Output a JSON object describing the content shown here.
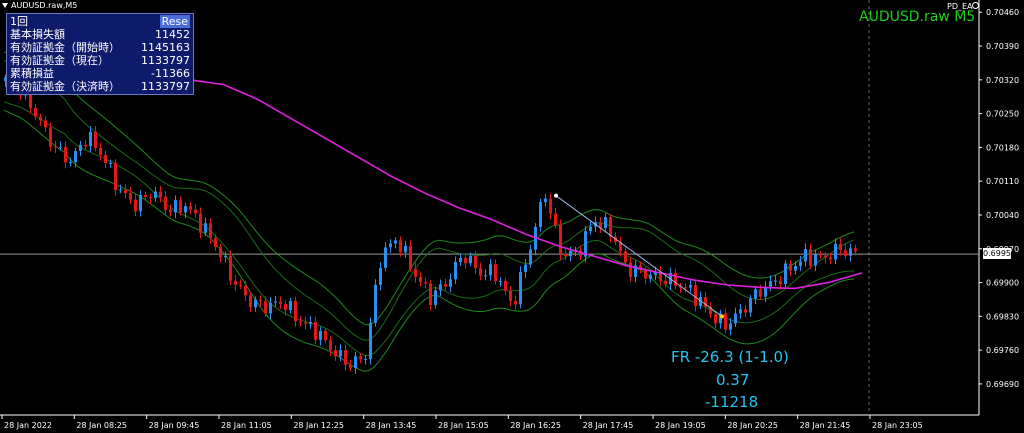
{
  "window": {
    "tab_label": "AUDUSD.raw,M5"
  },
  "info_panel": {
    "rows": [
      {
        "label": "1回",
        "value": "",
        "button": "Rese"
      },
      {
        "label": "基本損失額",
        "value": "11452"
      },
      {
        "label": "有効証拠金（開始時）",
        "value": "1145163"
      },
      {
        "label": "有効証拠金（現在）",
        "value": "1133797"
      },
      {
        "label": "累積損益",
        "value": "-11366"
      },
      {
        "label": "有効証拠金（決済時）",
        "value": "1133797"
      }
    ]
  },
  "ea": {
    "name": "PD_EA",
    "icon": "smiley-icon"
  },
  "watermark": "AUDUSD.raw M5",
  "current_price": "0.69959",
  "annotation": {
    "line1": "FR -26.3 (1-1.0)",
    "line2": "0.37",
    "line3": "-11218"
  },
  "colors": {
    "bull": "#2b8ff0",
    "bear": "#e01818",
    "ma": "#e020e0",
    "band_outer": "#1f8a1f",
    "band_inner": "#1a6a1a",
    "text_accent": "#22c4f0",
    "watermark": "#18d018"
  },
  "chart_data": {
    "type": "candlestick",
    "symbol": "AUDUSD.raw",
    "timeframe": "M5",
    "y_ticks": [
      "0.70460",
      "0.70390",
      "0.70320",
      "0.70250",
      "0.70180",
      "0.70110",
      "0.70040",
      "0.69970",
      "0.69900",
      "0.69830",
      "0.69760",
      "0.69690"
    ],
    "x_ticks": [
      "28 Jan 2022",
      "28 Jan 08:25",
      "28 Jan 09:45",
      "28 Jan 11:05",
      "28 Jan 12:25",
      "28 Jan 13:45",
      "28 Jan 15:05",
      "28 Jan 16:25",
      "28 Jan 17:45",
      "28 Jan 19:05",
      "28 Jan 20:25",
      "28 Jan 21:45",
      "28 Jan 23:05"
    ],
    "ylim": [
      0.69665,
      0.70475
    ],
    "close_path": [
      0.70317,
      0.703,
      0.7024,
      0.7018,
      0.7015,
      0.70205,
      0.7016,
      0.7009,
      0.7006,
      0.7009,
      0.7005,
      0.7006,
      0.7002,
      0.6997,
      0.699,
      0.6986,
      0.6985,
      0.6986,
      0.6982,
      0.698,
      0.6976,
      0.6973,
      0.69745,
      0.6996,
      0.6999,
      0.6992,
      0.6987,
      0.699,
      0.6996,
      0.6992,
      0.6992,
      0.6985,
      0.6996,
      0.7009,
      0.6996,
      0.6996,
      0.7003,
      0.7001,
      0.6993,
      0.6992,
      0.6991,
      0.699,
      0.6988,
      0.6984,
      0.6981,
      0.6984,
      0.6988,
      0.699,
      0.6993,
      0.69955,
      0.6995,
      0.6997,
      0.6996
    ],
    "ma_points": [
      0.7032,
      0.7031,
      0.7028,
      0.7024,
      0.702,
      0.7016,
      0.7012,
      0.70085,
      0.70055,
      0.7003,
      0.7,
      0.69975,
      0.69955,
      0.69935,
      0.6992,
      0.69905,
      0.69895,
      0.6989,
      0.69888,
      0.699,
      0.6992
    ]
  }
}
